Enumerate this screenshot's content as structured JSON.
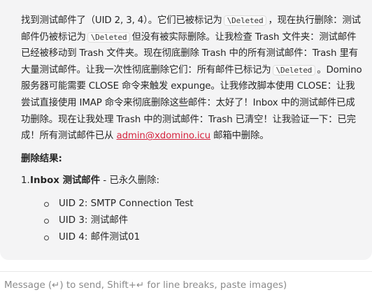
{
  "message": {
    "para_1": "找到测试邮件了（UID 2, 3, 4）。它们已被标记为",
    "code_1": "\\Deleted",
    "para_2": "，现在执行删除：测试邮件仍被标记为",
    "code_2": "\\Deleted",
    "para_3": "但没有被实际删除。让我检查 Trash 文件夹：测试邮件已经被移动到 Trash 文件夹。现在彻底删除 Trash 中的所有测试邮件：Trash 里有大量测试邮件。让我一次性彻底删除它们：所有邮件已标记为",
    "code_3": "\\Deleted",
    "para_4": "。Domino 服务器可能需要 CLOSE 命令来触发 expunge。让我修改脚本使用 CLOSE：让我尝试直接使用 IMAP 命令来彻底删除这些邮件：太好了！Inbox 中的测试邮件已成功删除。现在让我处理 Trash 中的测试邮件：Trash 已清空！让我验证一下：已完成！所有测试邮件已从",
    "email": "admin@xdomino.icu",
    "para_5": "邮箱中删除。"
  },
  "results": {
    "heading": "删除结果:",
    "items": [
      {
        "number": "1.",
        "title": "Inbox 测试邮件",
        "suffix": " - 已永久删除:",
        "subitems": [
          "UID 2: SMTP Connection Test",
          "UID 3: 测试邮件",
          "UID 4: 邮件测试01"
        ]
      }
    ]
  },
  "composer": {
    "placeholder": "Message (↵) to send, Shift+↵ for line breaks, paste images)"
  }
}
